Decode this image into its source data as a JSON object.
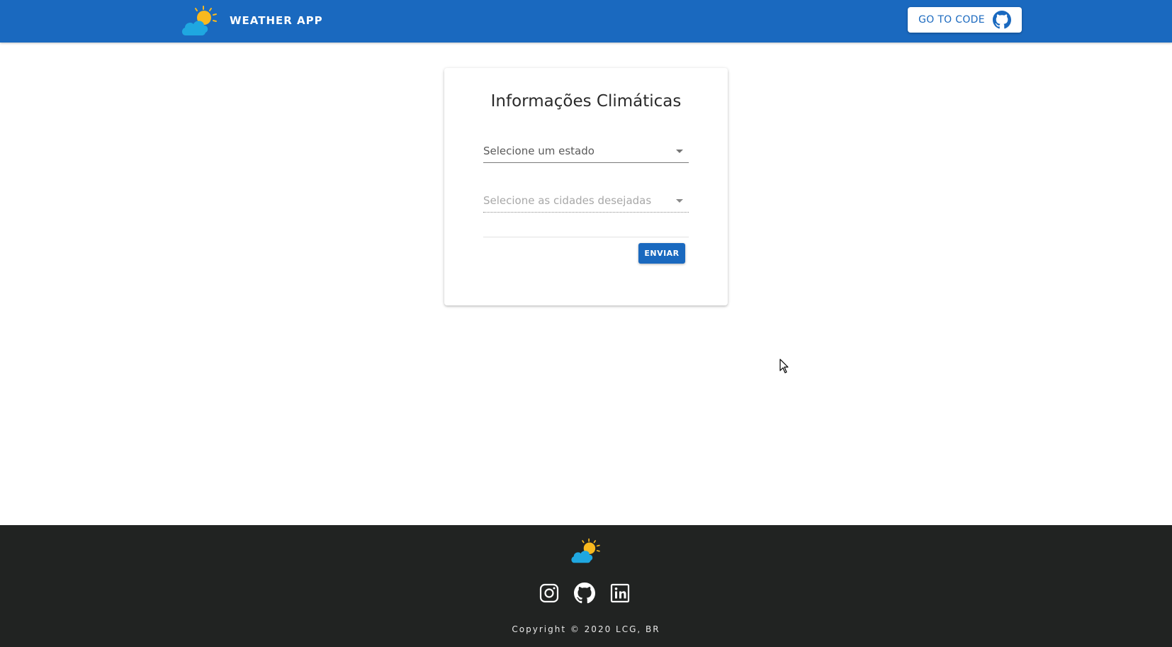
{
  "header": {
    "app_title": "WEATHER APP",
    "code_button_label": "GO TO CODE",
    "code_button_icon": "github-icon",
    "logo_icon": "sun-cloud-logo-icon",
    "background_color": "#1a69bf"
  },
  "form": {
    "title": "Informações Climáticas",
    "state_select": {
      "placeholder": "Selecione um estado",
      "icon": "caret-down-icon"
    },
    "cities_select": {
      "placeholder": "Selecione as cidades desejadas",
      "icon": "caret-down-icon"
    },
    "submit_label": "ENVIAR"
  },
  "footer": {
    "logo_icon": "sun-cloud-logo-icon",
    "social_icons": [
      "instagram-icon",
      "github-icon",
      "linkedin-icon"
    ],
    "copyright": "Copyright © 2020 LCG, BR",
    "background_color": "#212322"
  },
  "colors": {
    "primary": "#1a69bf",
    "sun": "#f9b91e",
    "cloud": "#1fa7e0"
  }
}
